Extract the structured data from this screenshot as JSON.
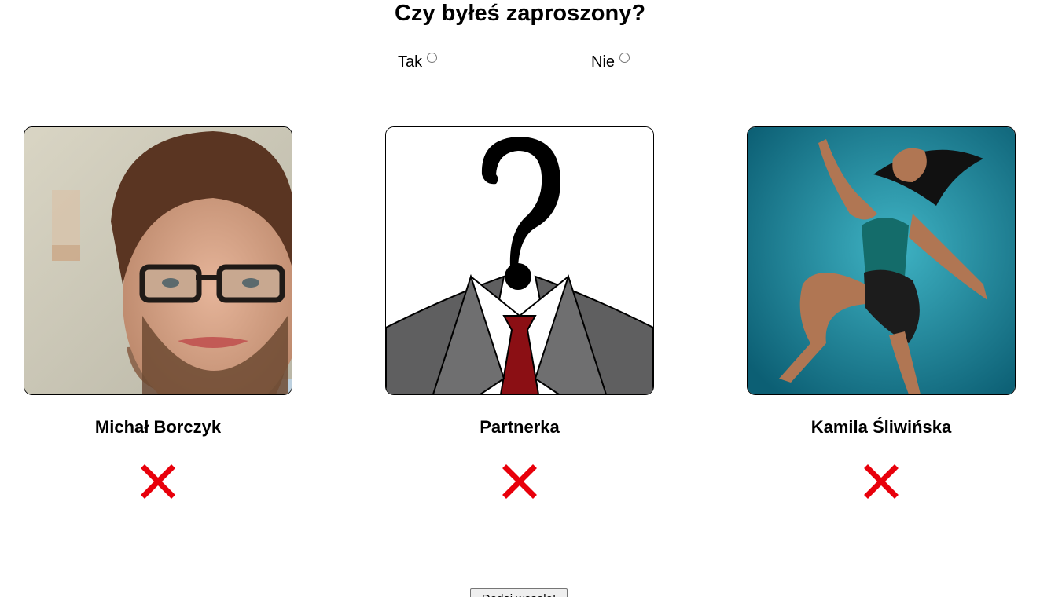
{
  "heading": "Czy byłeś zaproszony?",
  "radio_options": [
    {
      "label": "Tak",
      "checked": false
    },
    {
      "label": "Nie",
      "checked": false
    }
  ],
  "guests": [
    {
      "name": "Michał Borczyk",
      "photo_icon": "man-with-glasses-portrait"
    },
    {
      "name": "Partnerka",
      "photo_icon": "question-mark-suit-placeholder"
    },
    {
      "name": "Kamila Śliwińska",
      "photo_icon": "dancer-portrait"
    }
  ],
  "remove_icon": "red-x-icon",
  "colors": {
    "remove": "#e8000b",
    "background": "#ffffff"
  },
  "add_button_label": "Dodaj wesele!"
}
